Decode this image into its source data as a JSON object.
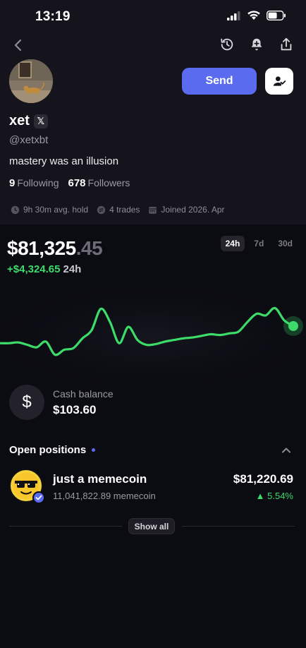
{
  "status": {
    "time": "13:19"
  },
  "profile": {
    "name": "xet",
    "x_badge": "𝕏",
    "handle": "@xetxbt",
    "bio": "mastery was an illusion",
    "following_count": "9",
    "following_label": "Following",
    "followers_count": "678",
    "followers_label": "Followers",
    "avg_hold": "9h 30m avg. hold",
    "trades": "4 trades",
    "joined": "Joined 2026. Apr",
    "send_label": "Send"
  },
  "portfolio": {
    "balance_whole": "$81,325",
    "balance_cents": ".45",
    "change": "+$4,324.65",
    "change_period": "24h",
    "ranges": [
      "24h",
      "7d",
      "30d"
    ],
    "selected_range": "24h",
    "accent_color": "#3ddc6a"
  },
  "cash": {
    "label": "Cash balance",
    "value": "$103.60",
    "icon": "dollar-icon"
  },
  "positions": {
    "title": "Open positions",
    "items": [
      {
        "name": "just a memecoin",
        "amount": "11,041,822.89 memecoin",
        "value": "$81,220.69",
        "change": "5.54%"
      }
    ],
    "show_all_label": "Show all"
  },
  "chart_data": {
    "type": "line",
    "series": [
      {
        "values": [
          0.36,
          0.36,
          0.37,
          0.34,
          0.31,
          0.38,
          0.22,
          0.28,
          0.3,
          0.42,
          0.52,
          0.78,
          0.62,
          0.36,
          0.56,
          0.4,
          0.34,
          0.35,
          0.38,
          0.4,
          0.42,
          0.43,
          0.45,
          0.47,
          0.46,
          0.48,
          0.5,
          0.62,
          0.72,
          0.7,
          0.79,
          0.64,
          0.57
        ]
      }
    ]
  }
}
